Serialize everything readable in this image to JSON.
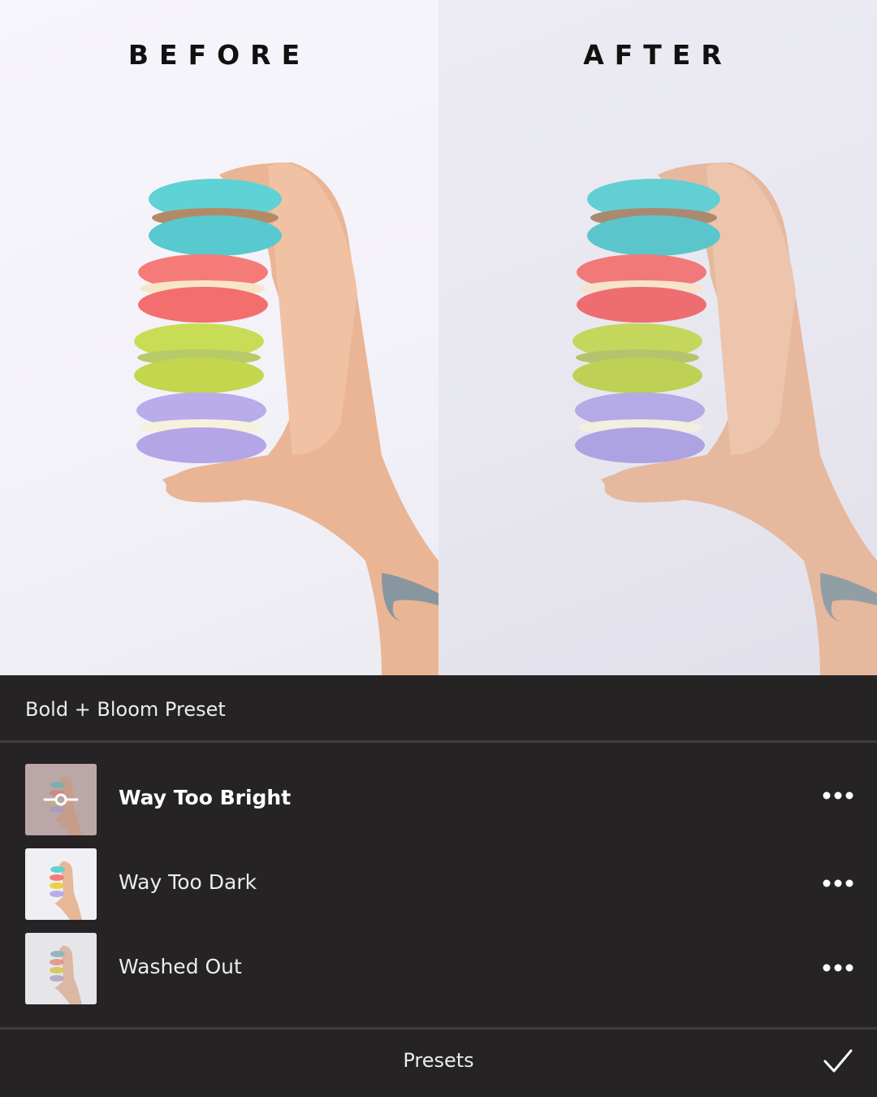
{
  "comparison": {
    "before_label": "BEFORE",
    "after_label": "AFTER"
  },
  "panel": {
    "title": "Bold + Bloom Preset",
    "presets": [
      {
        "label": "Way Too Bright",
        "selected": true,
        "thumbnail_icon": "adjust-slider-icon"
      },
      {
        "label": "Way Too Dark",
        "selected": false
      },
      {
        "label": "Washed Out",
        "selected": false
      }
    ],
    "more_icon": "ellipsis-icon",
    "footer_label": "Presets",
    "confirm_icon": "checkmark-icon"
  },
  "colors": {
    "panel_bg": "#262324",
    "macaron_teal": "#5fd2d6",
    "macaron_pink": "#f57b78",
    "macaron_green": "#c9dc55",
    "macaron_lavender": "#b9acea"
  }
}
